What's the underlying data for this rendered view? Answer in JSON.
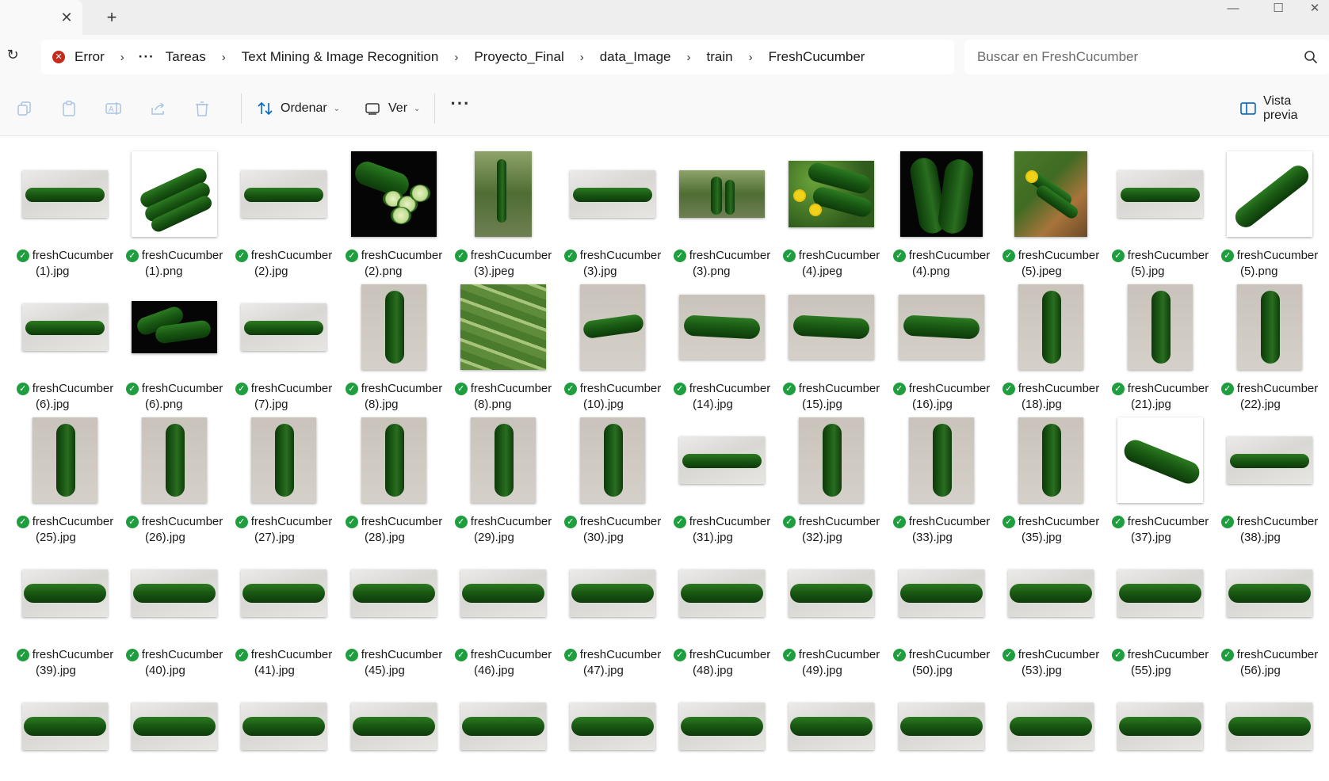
{
  "window": {
    "tab_close_icon": "close-icon",
    "new_tab_icon": "plus-icon",
    "controls": {
      "minimize": "—",
      "maximize": "☐",
      "close": "✕"
    }
  },
  "address": {
    "status": "Error",
    "overflow": "···",
    "crumbs": [
      "Tareas",
      "Text Mining & Image Recognition",
      "Proyecto_Final",
      "data_Image",
      "train",
      "FreshCucumber"
    ],
    "search_placeholder": "Buscar en FreshCucumber"
  },
  "toolbar": {
    "sort_label": "Ordenar",
    "view_label": "Ver",
    "more": "···",
    "preview_label": "Vista previa"
  },
  "files": [
    {
      "line1": "freshCucumber",
      "line2": "(1).jpg",
      "thumb": "sheet-h"
    },
    {
      "line1": "freshCucumber",
      "line2": "(1).png",
      "thumb": "white-group"
    },
    {
      "line1": "freshCucumber",
      "line2": "(2).jpg",
      "thumb": "sheet-h"
    },
    {
      "line1": "freshCucumber",
      "line2": "(2).png",
      "thumb": "black-slices"
    },
    {
      "line1": "freshCucumber",
      "line2": "(3).jpeg",
      "thumb": "plant"
    },
    {
      "line1": "freshCucumber",
      "line2": "(3).jpg",
      "thumb": "sheet-h"
    },
    {
      "line1": "freshCucumber",
      "line2": "(3).png",
      "thumb": "garden"
    },
    {
      "line1": "freshCucumber",
      "line2": "(4).jpeg",
      "thumb": "leaf-flowers"
    },
    {
      "line1": "freshCucumber",
      "line2": "(4).png",
      "thumb": "black-pair"
    },
    {
      "line1": "freshCucumber",
      "line2": "(5).jpeg",
      "thumb": "basket"
    },
    {
      "line1": "freshCucumber",
      "line2": "(5).jpg",
      "thumb": "sheet-h"
    },
    {
      "line1": "freshCucumber",
      "line2": "(5).png",
      "thumb": "white-diag"
    },
    {
      "line1": "freshCucumber",
      "line2": "(6).jpg",
      "thumb": "sheet-h"
    },
    {
      "line1": "freshCucumber",
      "line2": "(6).png",
      "thumb": "black-group"
    },
    {
      "line1": "freshCucumber",
      "line2": "(7).jpg",
      "thumb": "sheet-h"
    },
    {
      "line1": "freshCucumber",
      "line2": "(8).jpg",
      "thumb": "wall-v"
    },
    {
      "line1": "freshCucumber",
      "line2": "(8).png",
      "thumb": "pile"
    },
    {
      "line1": "freshCucumber",
      "line2": "(10).jpg",
      "thumb": "wall-curve"
    },
    {
      "line1": "freshCucumber",
      "line2": "(14).jpg",
      "thumb": "wall-wide"
    },
    {
      "line1": "freshCucumber",
      "line2": "(15).jpg",
      "thumb": "wall-wide"
    },
    {
      "line1": "freshCucumber",
      "line2": "(16).jpg",
      "thumb": "wall-wide"
    },
    {
      "line1": "freshCucumber",
      "line2": "(18).jpg",
      "thumb": "wall-v"
    },
    {
      "line1": "freshCucumber",
      "line2": "(21).jpg",
      "thumb": "wall-v"
    },
    {
      "line1": "freshCucumber",
      "line2": "(22).jpg",
      "thumb": "wall-v"
    },
    {
      "line1": "freshCucumber",
      "line2": "(25).jpg",
      "thumb": "wall-v"
    },
    {
      "line1": "freshCucumber",
      "line2": "(26).jpg",
      "thumb": "wall-v"
    },
    {
      "line1": "freshCucumber",
      "line2": "(27).jpg",
      "thumb": "wall-v"
    },
    {
      "line1": "freshCucumber",
      "line2": "(28).jpg",
      "thumb": "wall-v"
    },
    {
      "line1": "freshCucumber",
      "line2": "(29).jpg",
      "thumb": "wall-v"
    },
    {
      "line1": "freshCucumber",
      "line2": "(30).jpg",
      "thumb": "wall-v"
    },
    {
      "line1": "freshCucumber",
      "line2": "(31).jpg",
      "thumb": "sheet-h"
    },
    {
      "line1": "freshCucumber",
      "line2": "(32).jpg",
      "thumb": "wall-v"
    },
    {
      "line1": "freshCucumber",
      "line2": "(33).jpg",
      "thumb": "wall-v"
    },
    {
      "line1": "freshCucumber",
      "line2": "(35).jpg",
      "thumb": "wall-v"
    },
    {
      "line1": "freshCucumber",
      "line2": "(37).jpg",
      "thumb": "white-diag2"
    },
    {
      "line1": "freshCucumber",
      "line2": "(38).jpg",
      "thumb": "sheet-h"
    },
    {
      "line1": "freshCucumber",
      "line2": "(39).jpg",
      "thumb": "sheet-h2"
    },
    {
      "line1": "freshCucumber",
      "line2": "(40).jpg",
      "thumb": "sheet-h2"
    },
    {
      "line1": "freshCucumber",
      "line2": "(41).jpg",
      "thumb": "sheet-h2"
    },
    {
      "line1": "freshCucumber",
      "line2": "(45).jpg",
      "thumb": "sheet-h2"
    },
    {
      "line1": "freshCucumber",
      "line2": "(46).jpg",
      "thumb": "sheet-h2"
    },
    {
      "line1": "freshCucumber",
      "line2": "(47).jpg",
      "thumb": "sheet-h2"
    },
    {
      "line1": "freshCucumber",
      "line2": "(48).jpg",
      "thumb": "sheet-h2"
    },
    {
      "line1": "freshCucumber",
      "line2": "(49).jpg",
      "thumb": "sheet-h2"
    },
    {
      "line1": "freshCucumber",
      "line2": "(50).jpg",
      "thumb": "sheet-h2"
    },
    {
      "line1": "freshCucumber",
      "line2": "(53).jpg",
      "thumb": "sheet-h2"
    },
    {
      "line1": "freshCucumber",
      "line2": "(55).jpg",
      "thumb": "sheet-h2"
    },
    {
      "line1": "freshCucumber",
      "line2": "(56).jpg",
      "thumb": "sheet-h2"
    },
    {
      "thumb": "sheet-h2"
    },
    {
      "thumb": "sheet-h2"
    },
    {
      "thumb": "sheet-h2"
    },
    {
      "thumb": "sheet-h2"
    },
    {
      "thumb": "sheet-h2"
    },
    {
      "thumb": "sheet-h2"
    },
    {
      "thumb": "sheet-h2"
    },
    {
      "thumb": "sheet-h2"
    },
    {
      "thumb": "sheet-h2"
    },
    {
      "thumb": "sheet-h2"
    },
    {
      "thumb": "sheet-h2"
    },
    {
      "thumb": "sheet-h2"
    }
  ],
  "colors": {
    "sync_ok": "#1f9e3f",
    "error": "#c42b1c",
    "accent": "#0067c0"
  }
}
